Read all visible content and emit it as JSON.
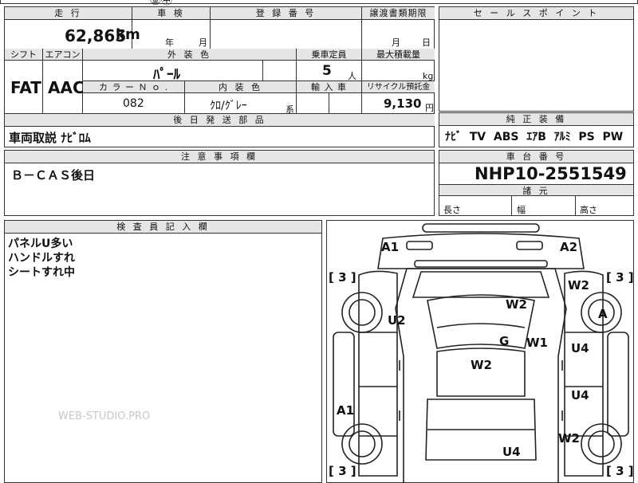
{
  "top_fragment": "㊎㊥",
  "mileage": {
    "label": "走 行",
    "value": "62,865",
    "unit": "km"
  },
  "inspection": {
    "label": "車 検",
    "year_unit": "年",
    "month_unit": "月"
  },
  "registration": {
    "label": "登 録 番 号"
  },
  "transfer_date": {
    "label": "譲渡書類期限",
    "month_unit": "月",
    "day_unit": "日"
  },
  "sales_points": {
    "label": "セ ー ル ス ポ イ ン ト"
  },
  "shift": {
    "label": "シフト",
    "value": "FAT"
  },
  "aircon": {
    "label": "エアコン",
    "value": "AAC"
  },
  "exterior_color": {
    "label": "外 装 色",
    "value": "ﾊﾟｰﾙ"
  },
  "capacity": {
    "label": "乗車定員",
    "value": "5",
    "unit": "人"
  },
  "max_load": {
    "label": "最大積載量",
    "unit": "kg"
  },
  "color_no": {
    "label": "カ ラ ー Ｎ ｏ .",
    "value": "082"
  },
  "interior_color": {
    "label": "内 装 色",
    "value": "ｸﾛ/ｸﾞﾚｰ",
    "suffix": "系"
  },
  "import": {
    "label": "輸 入 車"
  },
  "recycle": {
    "label": "リサイクル預託金",
    "value": "9,130",
    "unit": "円"
  },
  "later_parts": {
    "label": "後 日 発 送 部 品",
    "value": "車両取説 ﾅﾋﾞﾛﾑ"
  },
  "genuine_equipment": {
    "label": "純 正 装 備",
    "value": "ﾅﾋﾞ  TV  ABS  ｴｱB  ｱﾙﾐ  PS  PW"
  },
  "notes": {
    "label": "注 意 事 項 欄",
    "value": "Ｂ－ＣＡＳ後日"
  },
  "chassis": {
    "label": "車 台 番 号",
    "value": "NHP10-2551549"
  },
  "dimensions": {
    "label": "諸 元",
    "length": "長さ",
    "width": "幅",
    "height": "高さ"
  },
  "inspector": {
    "label": "検 査 員 記 入 欄",
    "lines": [
      "パネルU多い",
      "ハンドルすれ",
      "シートすれ中"
    ]
  },
  "watermark": "WEB-STUDIO.PRO",
  "diagram": {
    "marks": [
      "A1",
      "A2",
      "W2",
      "W2",
      "U2",
      "A",
      "G",
      "W1",
      "U4",
      "W2",
      "U4",
      "A1",
      "W2",
      "U4"
    ],
    "brackets": [
      "[ 3 ]",
      "[ 3 ]",
      "[ 3 ]",
      "[ 3 ]"
    ]
  }
}
